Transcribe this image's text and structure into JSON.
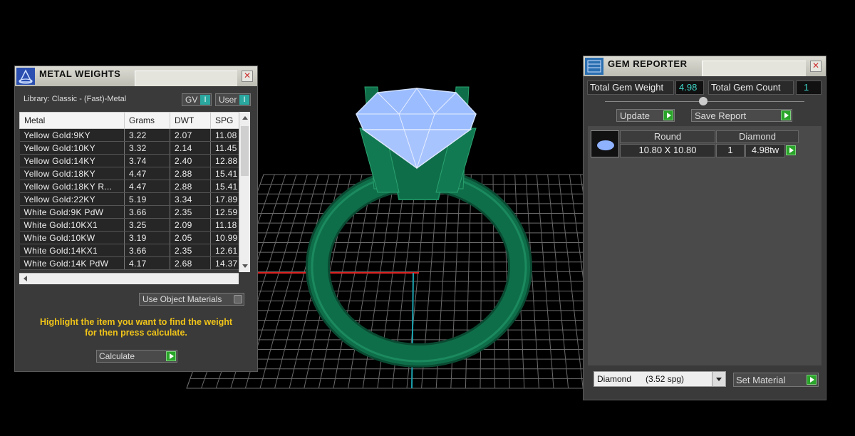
{
  "metal_weights": {
    "title": "METAL WEIGHTS",
    "library": "Library: Classic - (Fast)-Metal",
    "gv_label": "GV",
    "user_label": "User",
    "toggle_glyph": "I",
    "columns": [
      "Metal",
      "Grams",
      "DWT",
      "SPG"
    ],
    "rows": [
      {
        "metal": "Yellow Gold:9KY",
        "grams": "3.22",
        "dwt": "2.07",
        "spg": "11.08"
      },
      {
        "metal": "Yellow Gold:10KY",
        "grams": "3.32",
        "dwt": "2.14",
        "spg": "11.45"
      },
      {
        "metal": "Yellow Gold:14KY",
        "grams": "3.74",
        "dwt": "2.40",
        "spg": "12.88"
      },
      {
        "metal": "Yellow Gold:18KY",
        "grams": "4.47",
        "dwt": "2.88",
        "spg": "15.41"
      },
      {
        "metal": "Yellow Gold:18KY R...",
        "grams": "4.47",
        "dwt": "2.88",
        "spg": "15.41"
      },
      {
        "metal": "Yellow Gold:22KY",
        "grams": "5.19",
        "dwt": "3.34",
        "spg": "17.89"
      },
      {
        "metal": "White Gold:9K PdW",
        "grams": "3.66",
        "dwt": "2.35",
        "spg": "12.59"
      },
      {
        "metal": "White Gold:10KX1",
        "grams": "3.25",
        "dwt": "2.09",
        "spg": "11.18"
      },
      {
        "metal": "White Gold:10KW",
        "grams": "3.19",
        "dwt": "2.05",
        "spg": "10.99"
      },
      {
        "metal": "White Gold:14KX1",
        "grams": "3.66",
        "dwt": "2.35",
        "spg": "12.61"
      },
      {
        "metal": "White Gold:14K PdW",
        "grams": "4.17",
        "dwt": "2.68",
        "spg": "14.37"
      }
    ],
    "use_object_materials": "Use Object Materials",
    "hint_line1": "Highlight the item you want to find the weight",
    "hint_line2": "for then press calculate.",
    "calculate_label": "Calculate",
    "close_glyph": "✕"
  },
  "gem_reporter": {
    "title": "GEM REPORTER",
    "total_weight_label": "Total Gem Weight",
    "total_weight_value": "4.98",
    "total_count_label": "Total Gem Count",
    "total_count_value": "1",
    "update_label": "Update",
    "save_report_label": "Save Report",
    "gem": {
      "shape": "Round",
      "material": "Diamond",
      "size": "10.80 X 10.80",
      "count": "1",
      "weight": "4.98tw"
    },
    "material_select": "Diamond      (3.52 spg)",
    "set_material_label": "Set Material",
    "close_glyph": "✕"
  },
  "colors": {
    "ring_green": "#0f6e4a",
    "gem_blue": "#8fb2ff",
    "hint_yellow": "#f0c419",
    "accent_green": "#2aa52a",
    "teal": "#2aa8a0"
  }
}
